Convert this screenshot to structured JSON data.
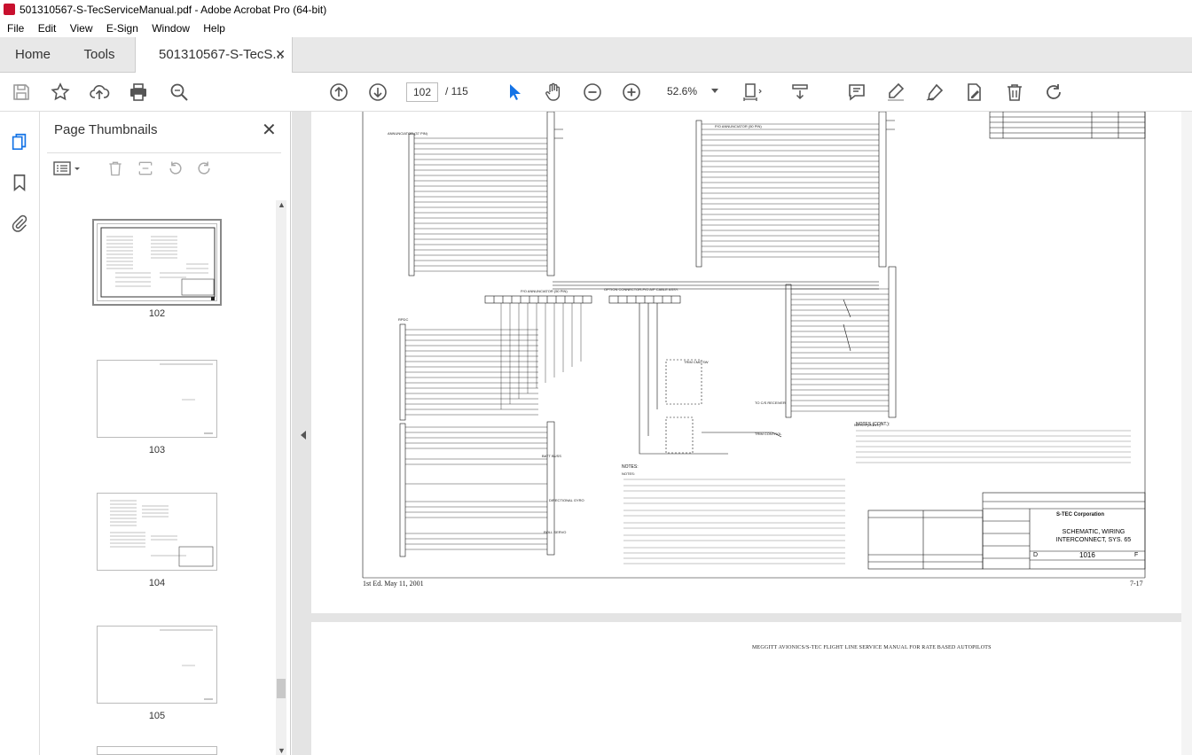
{
  "window": {
    "title": "501310567-S-TecServiceManual.pdf - Adobe Acrobat Pro (64-bit)"
  },
  "menu": [
    "File",
    "Edit",
    "View",
    "E-Sign",
    "Window",
    "Help"
  ],
  "tabs": {
    "home": "Home",
    "tools": "Tools",
    "doc": "501310567-S-TecS..."
  },
  "toolbar": {
    "page_current": "102",
    "page_total": "/ 115",
    "zoom": "52.6%"
  },
  "panel": {
    "title": "Page Thumbnails",
    "thumbs": [
      {
        "label": "102",
        "selected": true
      },
      {
        "label": "103",
        "selected": false
      },
      {
        "label": "104",
        "selected": false
      },
      {
        "label": "105",
        "selected": false
      }
    ]
  },
  "document": {
    "footer_left": "1st Ed. May 11, 2001",
    "footer_right": "7-17",
    "next_page_header": "MEGGITT AVIONICS/S-TEC FLIGHT LINE SERVICE MANUAL FOR RATE BASED AUTOPILOTS",
    "title_block": {
      "company": "S-TEC Corporation",
      "title_line1": "SCHEMATIC, WIRING",
      "title_line2": "INTERCONNECT, SYS. 65",
      "drawing_no": "1016",
      "size": "D",
      "rev": "F"
    },
    "notes_title": "NOTES:",
    "notes_cont_title": "NOTES (CONT.):"
  },
  "icons": {
    "save": "save-icon",
    "star": "star-icon",
    "upload": "upload-icon",
    "print": "print-icon",
    "search": "search-icon",
    "prev": "prev-page-icon",
    "next": "next-page-icon",
    "select": "select-cursor-icon",
    "hand": "hand-icon",
    "zoom_out": "zoom-out-icon",
    "zoom_in": "zoom-in-icon"
  }
}
